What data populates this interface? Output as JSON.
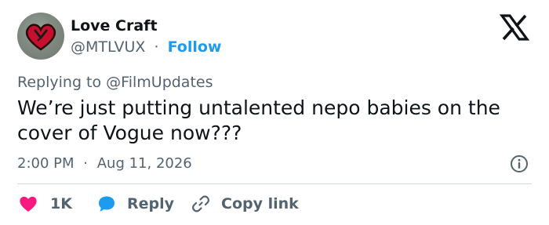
{
  "author": {
    "name": "Love Craft",
    "handle": "@MTLVUX",
    "separator": "·",
    "follow_label": "Follow"
  },
  "reply_context": {
    "prefix": "Replying to",
    "target": "@FilmUpdates"
  },
  "tweet": {
    "text_line1": "We’re just putting untalented nepo babies on the",
    "text_line2": "cover of Vogue now???"
  },
  "meta": {
    "time": "2:00 PM",
    "separator": "·",
    "date": "Aug 11, 2026"
  },
  "actions": {
    "like_count": "1K",
    "reply_label": "Reply",
    "copy_label": "Copy link"
  },
  "colors": {
    "like": "#f91880",
    "reply": "#1d9bf0",
    "accent": "#1d9bf0",
    "muted": "#536471",
    "text": "#0f1419"
  },
  "icons": {
    "brand": "x-logo-icon",
    "info": "info-icon",
    "like": "heart-icon",
    "reply": "speech-bubble-icon",
    "copy": "link-icon"
  }
}
